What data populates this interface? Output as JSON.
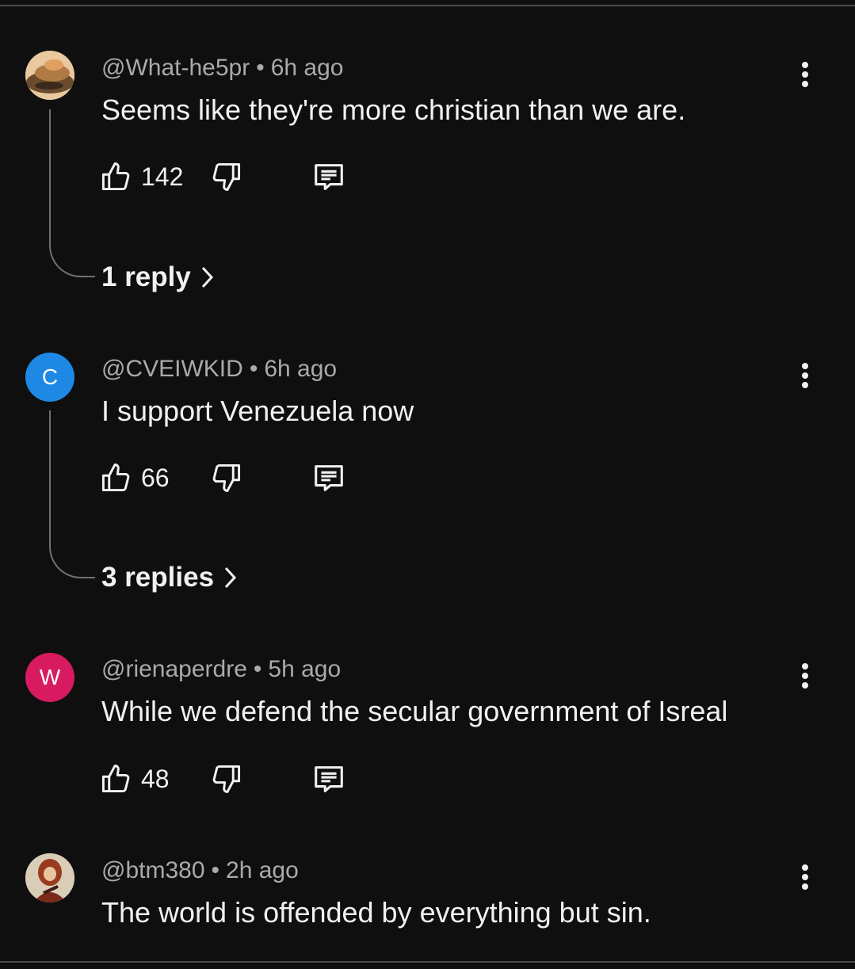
{
  "comments": [
    {
      "handle": "@What-he5pr",
      "separator": "•",
      "time": "6h ago",
      "text": "Seems like they're more christian than we are.",
      "likes": "142",
      "avatar_letter": "",
      "replies_label": "1 reply"
    },
    {
      "handle": "@CVEIWKID",
      "separator": "•",
      "time": "6h ago",
      "text": "I support Venezuela now",
      "likes": "66",
      "avatar_letter": "C",
      "avatar_color": "#1e88e5",
      "replies_label": "3 replies"
    },
    {
      "handle": "@rienaperdre",
      "separator": "•",
      "time": "5h ago",
      "text": "While we defend the secular government of Isreal",
      "likes": "48",
      "avatar_letter": "W",
      "avatar_color": "#d81b60"
    },
    {
      "handle": "@btm380",
      "separator": "•",
      "time": "2h ago",
      "text": "The world is offended by everything but sin.",
      "avatar_letter": ""
    }
  ],
  "icons": {
    "like": "thumbs-up-icon",
    "dislike": "thumbs-down-icon",
    "reply": "comment-icon",
    "menu": "more-vert-icon",
    "chevron": "chevron-right-icon"
  },
  "colors": {
    "background": "#0f0f0f",
    "text_primary": "#f1f1f1",
    "text_secondary": "#aaaaaa",
    "thread_line": "#717171"
  }
}
